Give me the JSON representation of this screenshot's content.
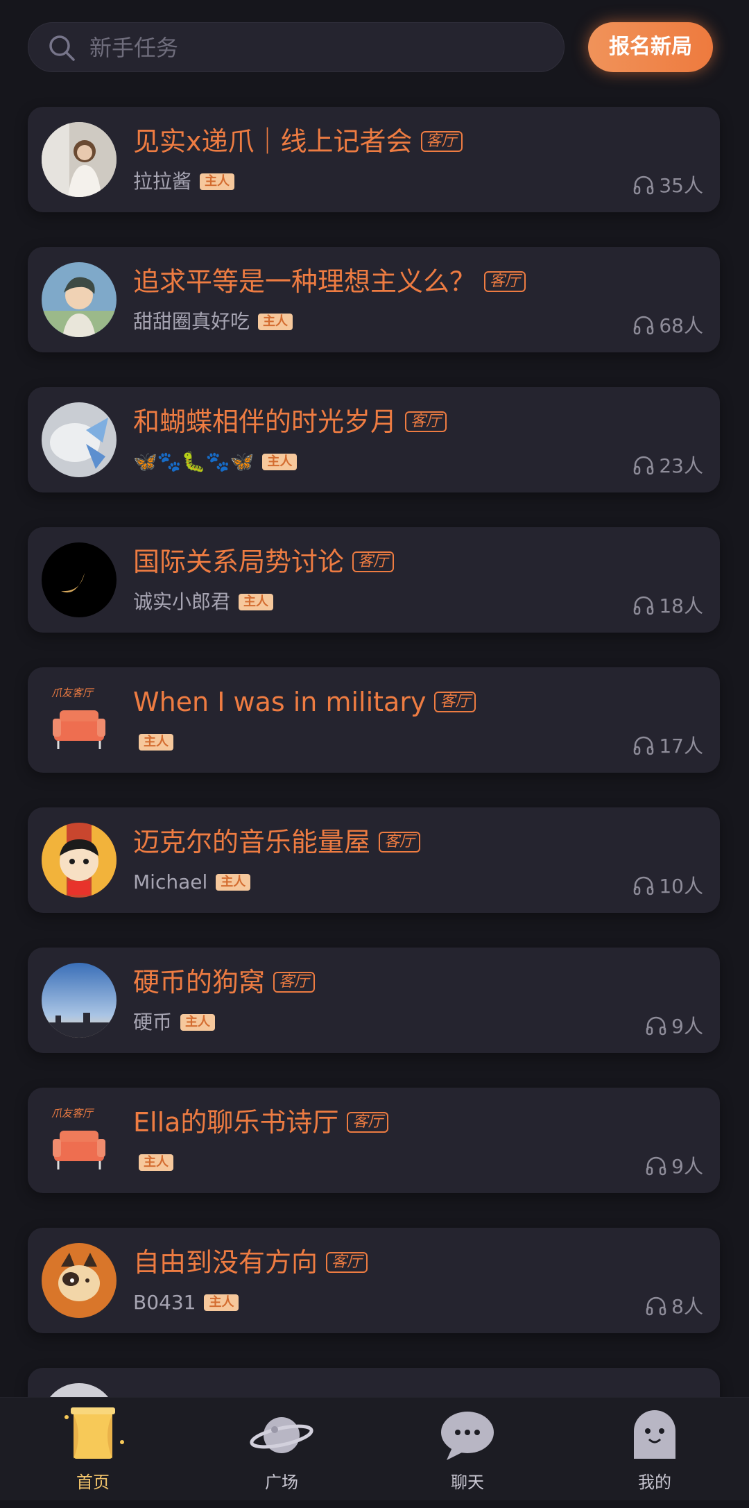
{
  "search": {
    "placeholder": "新手任务"
  },
  "signup_button": "报名新局",
  "room_tag": "客厅",
  "host_tag": "主人",
  "rooms": [
    {
      "title": "见实x递爪｜线上记者会",
      "host": "拉拉酱",
      "listeners": "35人"
    },
    {
      "title": "追求平等是一种理想主义么？",
      "host": "甜甜圈真好吃",
      "listeners": "68人"
    },
    {
      "title": "和蝴蝶相伴的时光岁月",
      "host": "🦋🐾🐛🐾🦋",
      "listeners": "23人"
    },
    {
      "title": "国际关系局势讨论",
      "host": "诚实小郎君",
      "listeners": "18人"
    },
    {
      "title": "When I was in military",
      "host": "",
      "listeners": "17人",
      "avatar_text": "爪友客厅"
    },
    {
      "title": "迈克尔的音乐能量屋",
      "host": "Michael",
      "listeners": "10人"
    },
    {
      "title": "硬币的狗窝",
      "host": "硬币",
      "listeners": "9人"
    },
    {
      "title": "Ella的聊乐书诗厅",
      "host": "",
      "listeners": "9人",
      "avatar_text": "爪友客厅"
    },
    {
      "title": "自由到没有方向",
      "host": "B0431",
      "listeners": "8人"
    }
  ],
  "tabs": [
    {
      "label": "首页",
      "active": true
    },
    {
      "label": "广场",
      "active": false
    },
    {
      "label": "聊天",
      "active": false
    },
    {
      "label": "我的",
      "active": false
    }
  ],
  "colors": {
    "accent": "#ee7c42",
    "background": "#16161c",
    "card": "#25242f",
    "active_tab": "#f2c46b"
  }
}
